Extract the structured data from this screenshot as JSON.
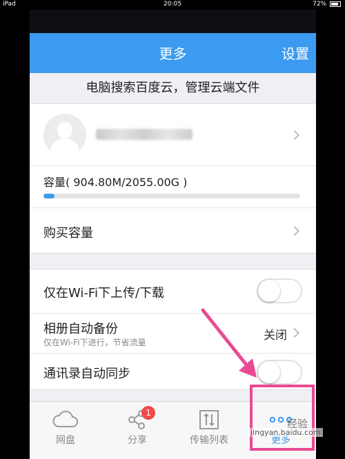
{
  "status_bar": {
    "device": "iPad",
    "time": "20:05",
    "battery": "72%"
  },
  "nav": {
    "title": "更多",
    "settings": "设置"
  },
  "subtitle": "电脑搜索百度云，管理云端文件",
  "profile": {
    "username": ""
  },
  "capacity": {
    "label": "容量( 904.80M/2055.00G )",
    "used_fraction": 0.044
  },
  "buy": {
    "label": "购买容量"
  },
  "settings": {
    "wifi_upload": {
      "label": "仅在Wi-Fi下上传/下载",
      "enabled": false
    },
    "album_backup": {
      "label": "相册自动备份",
      "sub": "仅在Wi-Fi下进行，节省流量",
      "value": "关闭"
    },
    "contacts_sync": {
      "label": "通讯录自动同步",
      "enabled": false
    }
  },
  "tabs": [
    {
      "label": "网盘",
      "icon": "cloud-icon"
    },
    {
      "label": "分享",
      "icon": "share-icon",
      "badge": "1"
    },
    {
      "label": "传输列表",
      "icon": "transfer-icon"
    },
    {
      "label": "更多",
      "icon": "more-dots-icon",
      "active": true
    }
  ],
  "colors": {
    "accent": "#3c9bf0",
    "badge": "#f04a4a",
    "annotation": "#ea4a93"
  },
  "watermark": {
    "text": "jingyan.baidu.com",
    "brand": "经验"
  }
}
